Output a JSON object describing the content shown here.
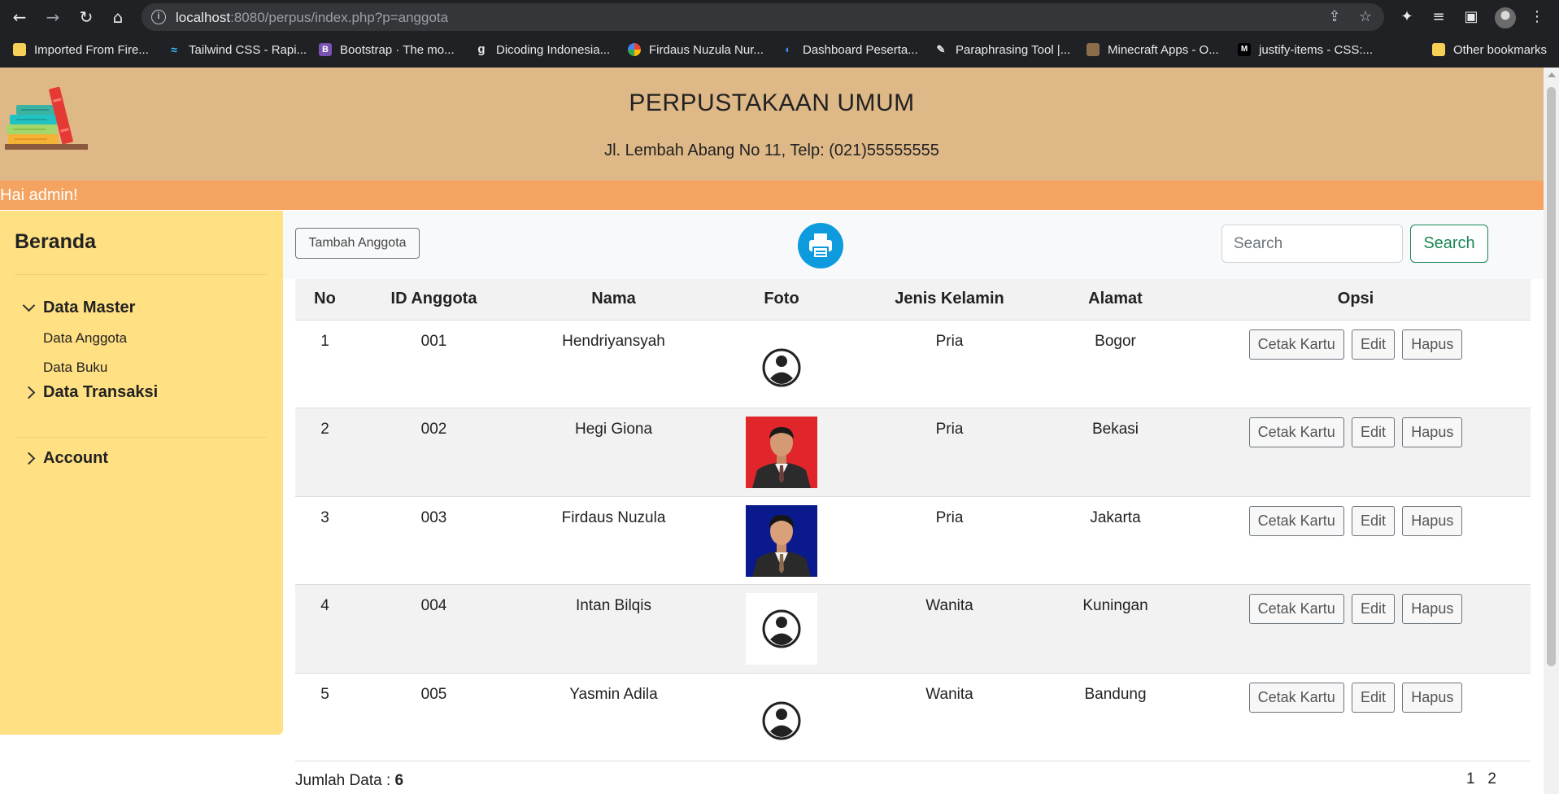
{
  "browser": {
    "url_host": "localhost",
    "url_rest": ":8080/perpus/index.php?p=anggota",
    "bookmarks": [
      {
        "label": "Imported From Fire...",
        "icon": "folder-icon"
      },
      {
        "label": "Tailwind CSS - Rapi...",
        "icon": "tailwind-icon"
      },
      {
        "label": "Bootstrap · The mo...",
        "icon": "bootstrap-icon"
      },
      {
        "label": "Dicoding Indonesia...",
        "icon": "dicoding-icon"
      },
      {
        "label": "Firdaus Nuzula Nur...",
        "icon": "site-icon"
      },
      {
        "label": "Dashboard Peserta...",
        "icon": "site-icon"
      },
      {
        "label": "Paraphrasing Tool |...",
        "icon": "feather-icon"
      },
      {
        "label": "Minecraft Apps - O...",
        "icon": "minecraft-icon"
      },
      {
        "label": "justify-items - CSS:...",
        "icon": "mdn-icon"
      }
    ],
    "other_bookmarks": "Other bookmarks"
  },
  "header": {
    "title": "PERPUSTAKAAN UMUM",
    "address": "Jl. Lembah Abang No 11, Telp: (021)55555555"
  },
  "greeting": "Hai admin!",
  "sidebar": {
    "home": "Beranda",
    "data_master": "Data Master",
    "data_master_items": [
      "Data Anggota",
      "Data Buku"
    ],
    "data_transaksi": "Data Transaksi",
    "account": "Account"
  },
  "toolbar": {
    "add_label": "Tambah Anggota",
    "search_placeholder": "Search",
    "search_button": "Search"
  },
  "table": {
    "headers": [
      "No",
      "ID Anggota",
      "Nama",
      "Foto",
      "Jenis Kelamin",
      "Alamat",
      "Opsi"
    ],
    "rows": [
      {
        "no": "1",
        "id": "001",
        "nama": "Hendriyansyah",
        "foto": "default-avatar",
        "jk": "Pria",
        "alamat": "Bogor"
      },
      {
        "no": "2",
        "id": "002",
        "nama": "Hegi Giona",
        "foto": "photo-red-background",
        "jk": "Pria",
        "alamat": "Bekasi"
      },
      {
        "no": "3",
        "id": "003",
        "nama": "Firdaus Nuzula",
        "foto": "photo-blue-background",
        "jk": "Pria",
        "alamat": "Jakarta"
      },
      {
        "no": "4",
        "id": "004",
        "nama": "Intan Bilqis",
        "foto": "default-avatar",
        "jk": "Wanita",
        "alamat": "Kuningan"
      },
      {
        "no": "5",
        "id": "005",
        "nama": "Yasmin Adila",
        "foto": "default-avatar",
        "jk": "Wanita",
        "alamat": "Bandung"
      }
    ],
    "actions": {
      "print_card": "Cetak Kartu",
      "edit": "Edit",
      "delete": "Hapus"
    }
  },
  "footer": {
    "total_label": "Jumlah Data : ",
    "total_value": "6",
    "pages": "1   2"
  },
  "colors": {
    "header_bg": "#deb887",
    "greet_bg": "#f4a460",
    "sidebar_bg": "#ffe082",
    "print_button": "#0d9bde",
    "search_button": "#198754"
  }
}
